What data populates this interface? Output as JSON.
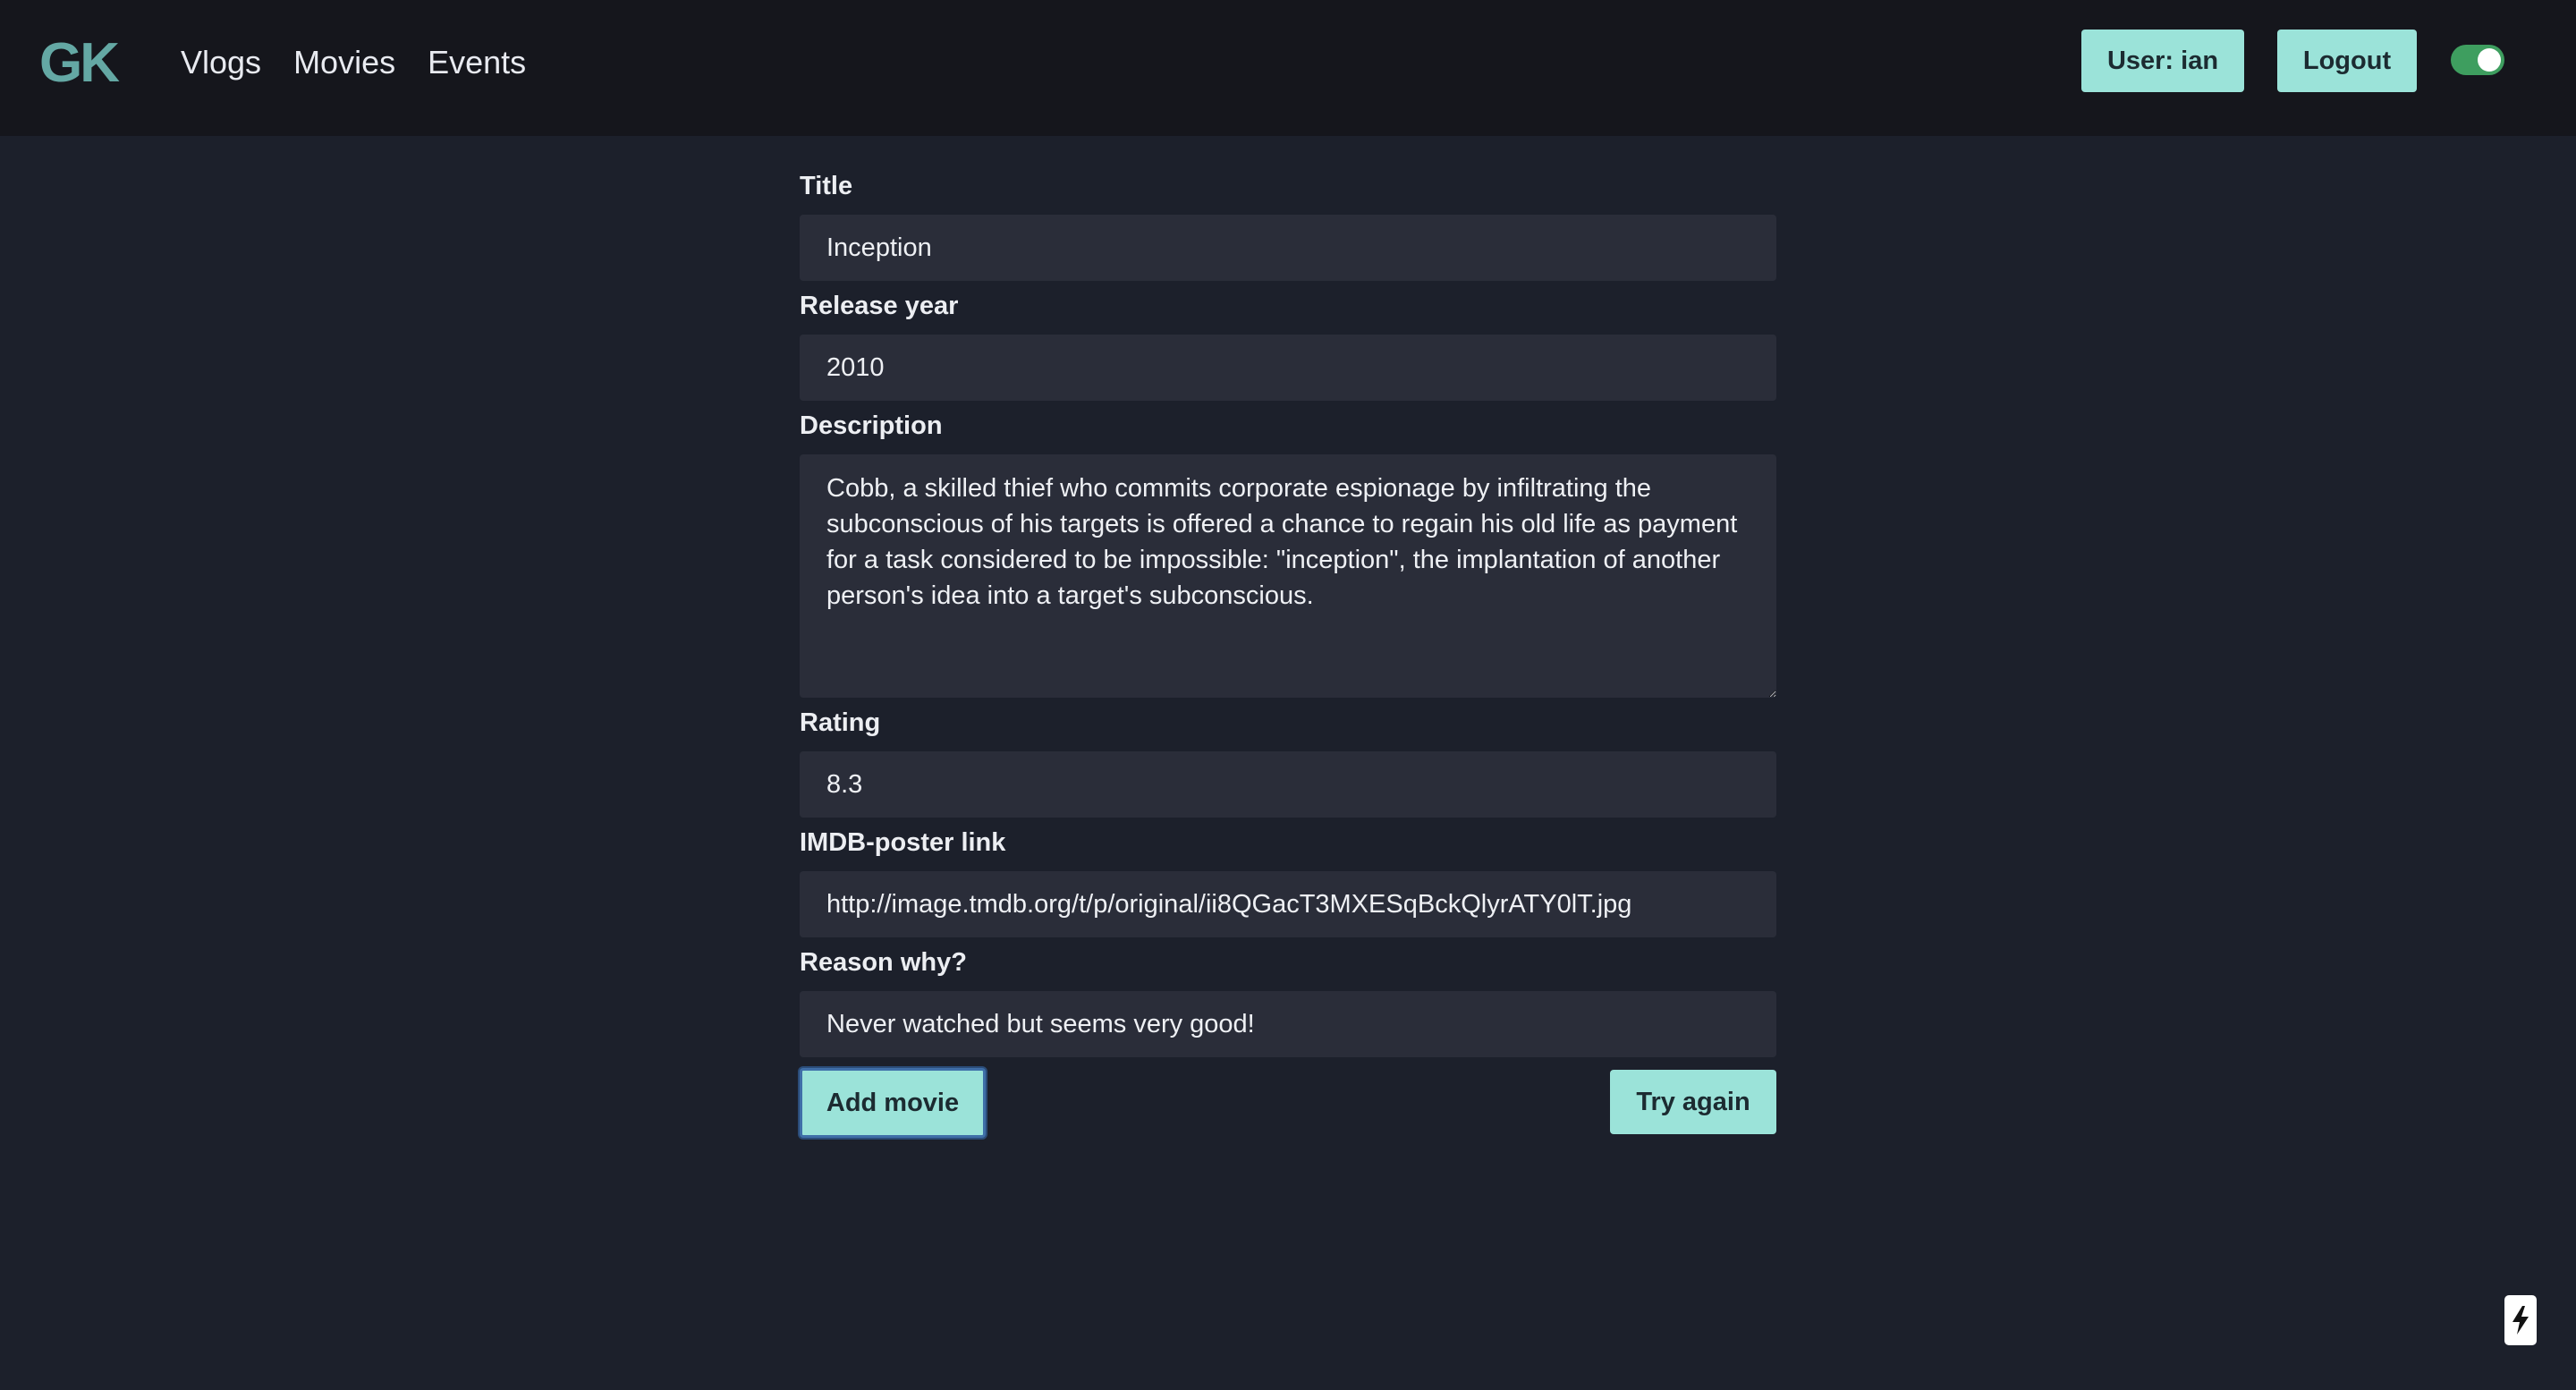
{
  "header": {
    "logo": "GK",
    "nav": [
      {
        "label": "Vlogs"
      },
      {
        "label": "Movies"
      },
      {
        "label": "Events"
      }
    ],
    "user_label": "User: ian",
    "logout_label": "Logout",
    "theme_toggle_on": true
  },
  "form": {
    "title": {
      "label": "Title",
      "value": "Inception"
    },
    "release_year": {
      "label": "Release year",
      "value": "2010"
    },
    "description": {
      "label": "Description",
      "value": "Cobb, a skilled thief who commits corporate espionage by infiltrating the subconscious of his targets is offered a chance to regain his old life as payment for a task considered to be impossible: \"inception\", the implantation of another person's idea into a target's subconscious."
    },
    "rating": {
      "label": "Rating",
      "value": "8.3"
    },
    "poster": {
      "label": "IMDB-poster link",
      "value": "http://image.tmdb.org/t/p/original/ii8QGacT3MXESqBckQlyrATY0lT.jpg"
    },
    "reason": {
      "label": "Reason why?",
      "value": "Never watched but seems very good!"
    },
    "add_label": "Add movie",
    "retry_label": "Try again"
  },
  "colors": {
    "accent": "#9be3d9",
    "logo": "#64a8a4",
    "toggle": "#3e9e5f",
    "background": "#1c202b",
    "navbar": "#15161c"
  },
  "icons": {
    "floating": "lightning-bolt-icon"
  }
}
